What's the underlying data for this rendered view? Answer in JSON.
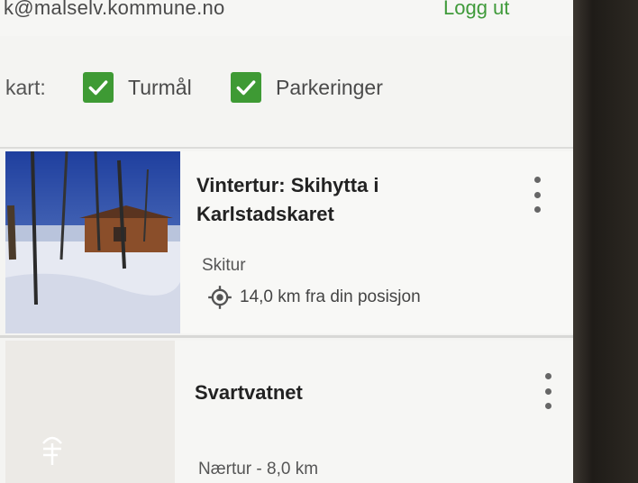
{
  "header": {
    "email": "k@malselv.kommune.no",
    "logout_label": "Logg ut"
  },
  "filters": {
    "label": "kart:",
    "items": [
      {
        "label": "Turmål",
        "checked": true
      },
      {
        "label": "Parkeringer",
        "checked": true
      }
    ]
  },
  "trips": [
    {
      "title_line1": "Vintertur: Skihytta i",
      "title_line2": "Karlstadskaret",
      "type": "Skitur",
      "distance": "14,0 km fra din posisjon"
    },
    {
      "title": "Svartvatnet",
      "meta": "Nærtur - 8,0 km"
    }
  ],
  "colors": {
    "accent_green": "#3e9a34",
    "logout_green": "#3f9a3a"
  },
  "icons": [
    "checkbox-checked-icon",
    "location-target-icon",
    "more-vert-icon",
    "app-logo-icon"
  ]
}
